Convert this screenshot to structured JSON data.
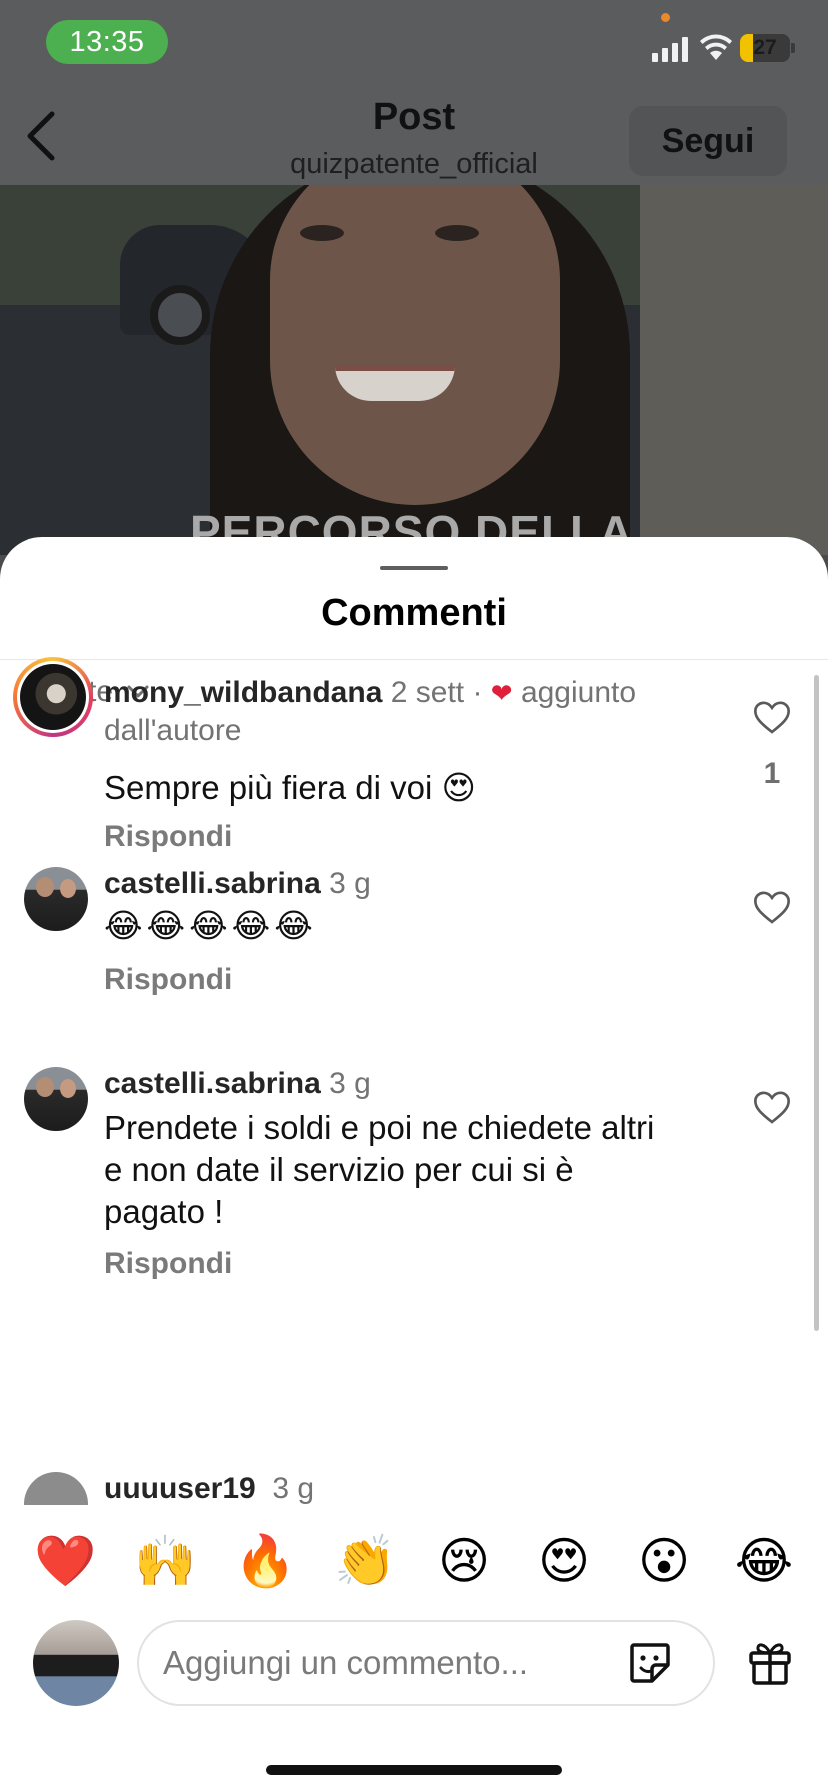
{
  "status_bar": {
    "time": "13:35",
    "battery": "27"
  },
  "header": {
    "title": "Post",
    "subtitle": "quizpatente_official",
    "follow_label": "Segui"
  },
  "video": {
    "caption": "PERCORSO DELLA"
  },
  "sheet": {
    "title": "Commenti",
    "sort_label": "Per te"
  },
  "comments": [
    {
      "username": "mony_wildbandana",
      "time": "2 sett",
      "separator": "·",
      "author_badge": "aggiunto",
      "author_badge_2": "dall'autore",
      "text": "Sempre più fiera di voi 😍",
      "reply_label": "Rispondi",
      "likes": "1"
    },
    {
      "username": "castelli.sabrina",
      "time": "3 g",
      "text": "😂😂😂😂😂",
      "reply_label": "Rispondi"
    },
    {
      "username": "castelli.sabrina",
      "time": "3 g",
      "text_line1": "Prendete i soldi e poi ne chiedete altri",
      "text_line2": "e non date il servizio per cui si è",
      "text_line3": "pagato !",
      "reply_label": "Rispondi"
    },
    {
      "username": "uuuuser19",
      "time": "3 g"
    }
  ],
  "quick_reactions": [
    "❤️",
    "🙌",
    "🔥",
    "👏",
    "😢",
    "😍",
    "😮",
    "😂"
  ],
  "composer": {
    "placeholder": "Aggiungi un commento..."
  },
  "icons": {
    "back": "chevron-left-icon",
    "sort": "chevron-down-icon",
    "like": "heart-outline-icon",
    "sticker": "sticker-icon",
    "gift": "gift-icon"
  },
  "colors": {
    "like_red": "#e0203a",
    "time_pill": "#4caf50"
  }
}
